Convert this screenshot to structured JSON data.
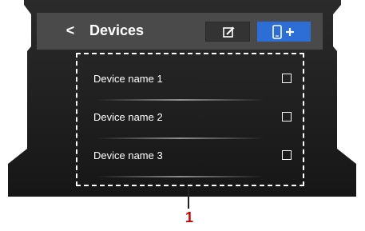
{
  "header": {
    "back_glyph": "<",
    "title": "Devices",
    "edit_icon": "edit-icon",
    "add_icon": "add-device-icon"
  },
  "devices": [
    {
      "name": "Device name 1",
      "checked": false
    },
    {
      "name": "Device name 2",
      "checked": false
    },
    {
      "name": "Device name 3",
      "checked": false
    }
  ],
  "callout": {
    "number": "1"
  },
  "colors": {
    "frame": "#222222",
    "header": "#4a4a4a",
    "accent": "#2d6ed6",
    "callout": "#cc0000"
  }
}
